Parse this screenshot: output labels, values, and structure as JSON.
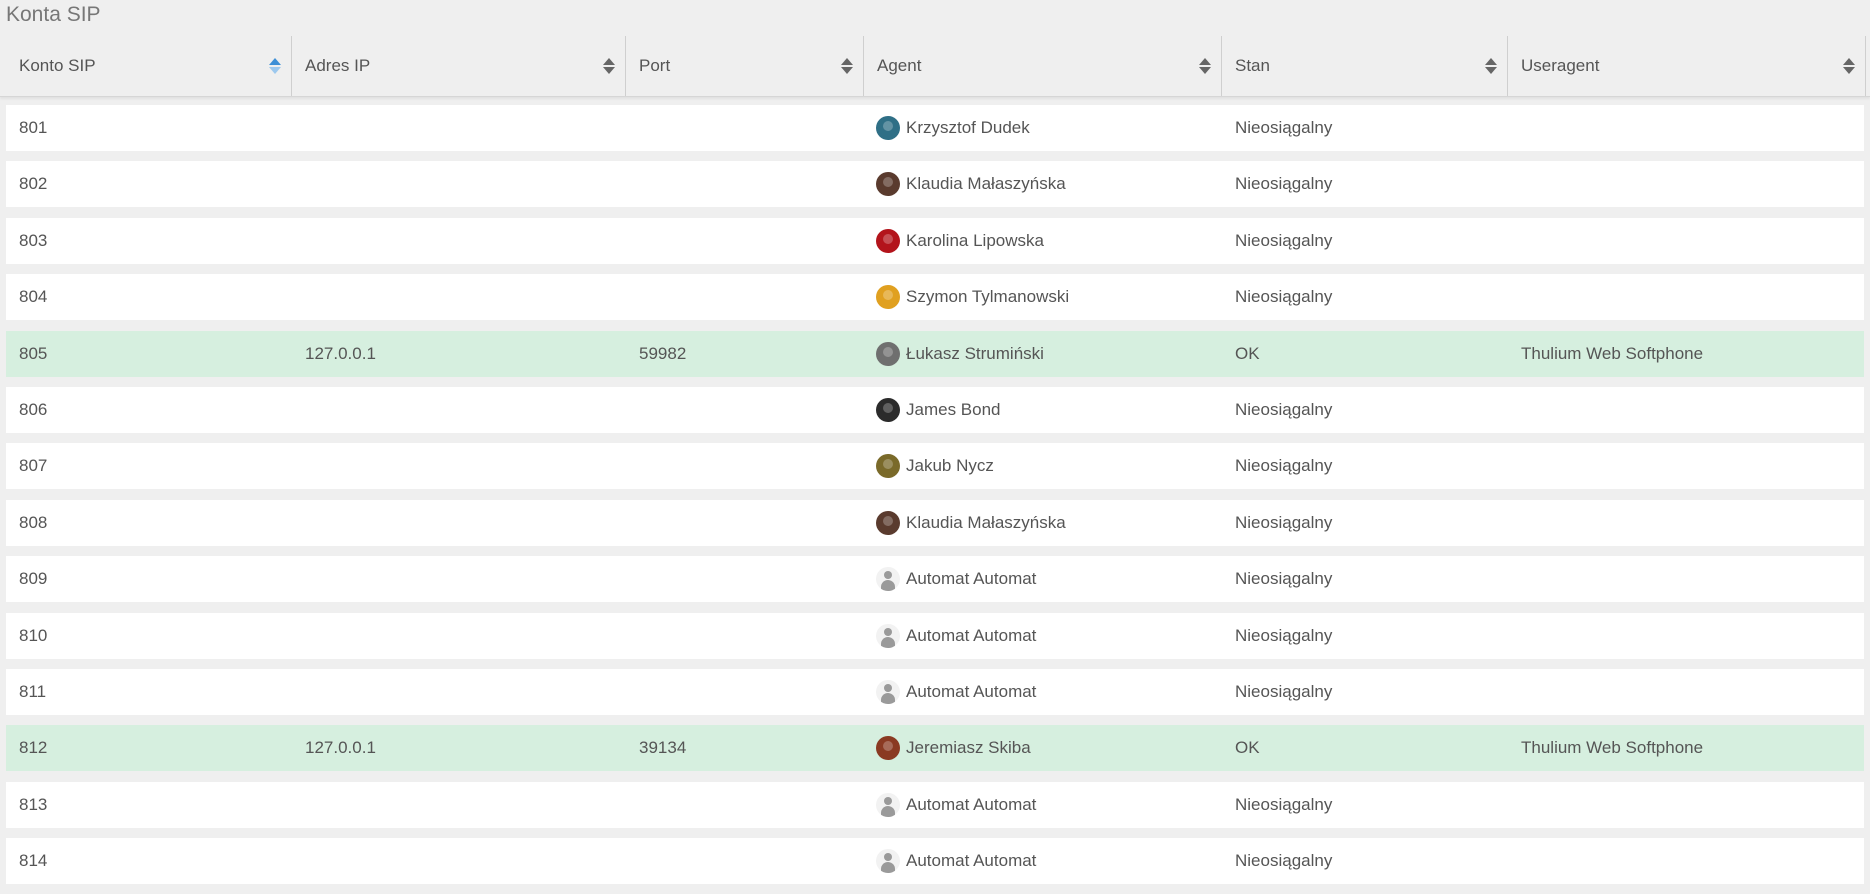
{
  "page": {
    "title": "Konta SIP"
  },
  "table": {
    "columns": [
      {
        "label": "Konto SIP",
        "sort": "active"
      },
      {
        "label": "Adres IP",
        "sort": "none"
      },
      {
        "label": "Port",
        "sort": "none"
      },
      {
        "label": "Agent",
        "sort": "none"
      },
      {
        "label": "Stan",
        "sort": "none"
      },
      {
        "label": "Useragent",
        "sort": "none"
      }
    ],
    "rows": [
      {
        "account": "801",
        "ip": "",
        "port": "",
        "agent": "Krzysztof Dudek",
        "avatar": "photo",
        "avatar_color": "#2f6f86",
        "state": "Nieosiągalny",
        "useragent": "",
        "status": "offline"
      },
      {
        "account": "802",
        "ip": "",
        "port": "",
        "agent": "Klaudia Małaszyńska",
        "avatar": "photo",
        "avatar_color": "#5a3b2e",
        "state": "Nieosiągalny",
        "useragent": "",
        "status": "offline"
      },
      {
        "account": "803",
        "ip": "",
        "port": "",
        "agent": "Karolina Lipowska",
        "avatar": "photo",
        "avatar_color": "#b3141b",
        "state": "Nieosiągalny",
        "useragent": "",
        "status": "offline"
      },
      {
        "account": "804",
        "ip": "",
        "port": "",
        "agent": "Szymon Tylmanowski",
        "avatar": "photo",
        "avatar_color": "#e0a020",
        "state": "Nieosiągalny",
        "useragent": "",
        "status": "offline"
      },
      {
        "account": "805",
        "ip": "127.0.0.1",
        "port": "59982",
        "agent": "Łukasz Strumiński",
        "avatar": "photo",
        "avatar_color": "#6f6f6f",
        "state": "OK",
        "useragent": "Thulium Web Softphone",
        "status": "ok"
      },
      {
        "account": "806",
        "ip": "",
        "port": "",
        "agent": "James Bond",
        "avatar": "photo",
        "avatar_color": "#2b2b2b",
        "state": "Nieosiągalny",
        "useragent": "",
        "status": "offline"
      },
      {
        "account": "807",
        "ip": "",
        "port": "",
        "agent": "Jakub Nycz",
        "avatar": "photo",
        "avatar_color": "#7a6a2a",
        "state": "Nieosiągalny",
        "useragent": "",
        "status": "offline"
      },
      {
        "account": "808",
        "ip": "",
        "port": "",
        "agent": "Klaudia Małaszyńska",
        "avatar": "photo",
        "avatar_color": "#5a3b2e",
        "state": "Nieosiągalny",
        "useragent": "",
        "status": "offline"
      },
      {
        "account": "809",
        "ip": "",
        "port": "",
        "agent": "Automat Automat",
        "avatar": "default",
        "avatar_color": "#9a9a9a",
        "state": "Nieosiągalny",
        "useragent": "",
        "status": "offline"
      },
      {
        "account": "810",
        "ip": "",
        "port": "",
        "agent": "Automat Automat",
        "avatar": "default",
        "avatar_color": "#9a9a9a",
        "state": "Nieosiągalny",
        "useragent": "",
        "status": "offline"
      },
      {
        "account": "811",
        "ip": "",
        "port": "",
        "agent": "Automat Automat",
        "avatar": "default",
        "avatar_color": "#9a9a9a",
        "state": "Nieosiągalny",
        "useragent": "",
        "status": "offline"
      },
      {
        "account": "812",
        "ip": "127.0.0.1",
        "port": "39134",
        "agent": "Jeremiasz Skiba",
        "avatar": "photo",
        "avatar_color": "#8a3a22",
        "state": "OK",
        "useragent": "Thulium Web Softphone",
        "status": "ok"
      },
      {
        "account": "813",
        "ip": "",
        "port": "",
        "agent": "Automat Automat",
        "avatar": "default",
        "avatar_color": "#9a9a9a",
        "state": "Nieosiągalny",
        "useragent": "",
        "status": "offline"
      },
      {
        "account": "814",
        "ip": "",
        "port": "",
        "agent": "Automat Automat",
        "avatar": "default",
        "avatar_color": "#9a9a9a",
        "state": "Nieosiągalny",
        "useragent": "",
        "status": "offline"
      }
    ]
  },
  "colors": {
    "background": "#efefef",
    "row_default": "#ffffff",
    "row_ok": "#d6efdf",
    "sort_active": "#3d8fd6",
    "text": "#555555"
  }
}
